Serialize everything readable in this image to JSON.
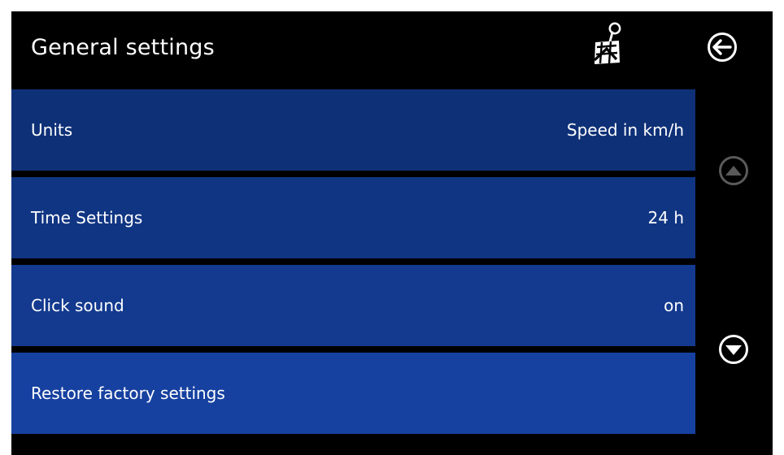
{
  "header": {
    "title": "General settings",
    "map_icon": "map-pin-icon",
    "back_icon": "back-arrow-icon"
  },
  "settings": {
    "items": [
      {
        "label": "Units",
        "value": "Speed in km/h"
      },
      {
        "label": "Time Settings",
        "value": "24 h"
      },
      {
        "label": "Click sound",
        "value": "on"
      },
      {
        "label": "Restore factory settings",
        "value": ""
      }
    ]
  },
  "scroll": {
    "up_icon": "scroll-up-icon",
    "up_enabled": false,
    "down_icon": "scroll-down-icon",
    "down_enabled": true
  },
  "colors": {
    "background": "#000000",
    "row_blue": "#133a8f",
    "text": "#ffffff",
    "disabled": "#5a5a5a"
  }
}
